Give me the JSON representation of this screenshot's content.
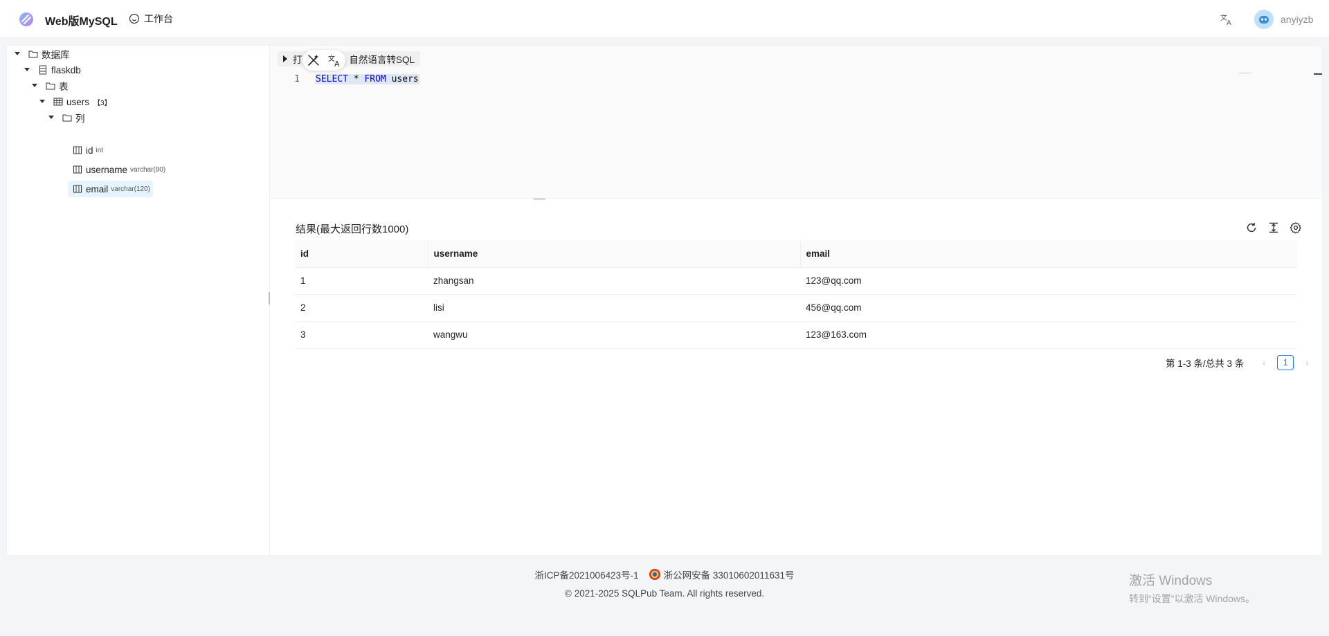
{
  "header": {
    "app_title": "Web版MySQL",
    "workbench_label": "工作台",
    "username": "anyiyzb"
  },
  "sidebar": {
    "database_root": "数据库",
    "db_name": "flaskdb",
    "tables_folder": "表",
    "table_name": "users",
    "table_count": "【3】",
    "columns_folder": "列",
    "columns": [
      {
        "name": "id",
        "type": "int"
      },
      {
        "name": "username",
        "type": "varchar(80)"
      },
      {
        "name": "email",
        "type": "varchar(120)"
      }
    ]
  },
  "editor": {
    "nl_prefix": "打",
    "nl_label": "自然语言转SQL",
    "line_number": "1",
    "sql": {
      "kw1": "SELECT",
      "star": "*",
      "kw2": "FROM",
      "ident": "users"
    }
  },
  "results": {
    "title": "结果(最大返回行数1000)",
    "headers": [
      "id",
      "username",
      "email"
    ],
    "rows": [
      [
        "1",
        "zhangsan",
        "123@qq.com"
      ],
      [
        "2",
        "lisi",
        "456@qq.com"
      ],
      [
        "3",
        "wangwu",
        "123@163.com"
      ]
    ],
    "pagination": {
      "summary": "第 1-3 条/总共 3 条",
      "current_page": "1",
      "prev": "‹",
      "next": "›"
    }
  },
  "footer": {
    "icp": "浙ICP备2021006423号-1",
    "police": "浙公网安备 33010602011631号",
    "copyright": "2021-2025 SQLPub Team. All rights reserved.",
    "copyright_symbol": "©"
  },
  "watermark": {
    "line1": "激活 Windows",
    "line2": "转到“设置”以激活 Windows。"
  },
  "colors": {
    "accent": "#1677ff",
    "selected_bg": "#e6f4ff",
    "keyword": "#0000ff"
  }
}
